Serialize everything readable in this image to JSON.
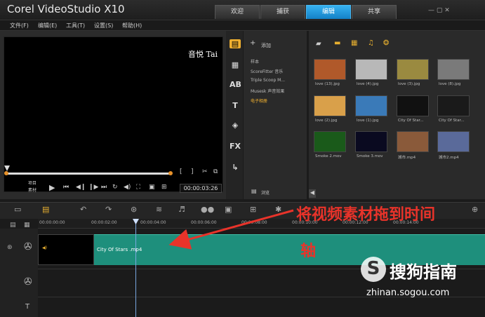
{
  "app": {
    "title": "Corel VideoStudio X10"
  },
  "workspace_tabs": [
    {
      "label": "欢迎"
    },
    {
      "label": "捕获"
    },
    {
      "label": "编辑"
    },
    {
      "label": "共享"
    }
  ],
  "menu": [
    {
      "label": "文件(F)"
    },
    {
      "label": "编辑(E)"
    },
    {
      "label": "工具(T)"
    },
    {
      "label": "设置(S)"
    },
    {
      "label": "帮助(H)"
    }
  ],
  "player": {
    "watermark": "音悦 Tai",
    "mode_project": "项目",
    "mode_clip": "素材",
    "timecode": "00:00:03:26"
  },
  "library": {
    "add_label": "添加",
    "browse_label": "浏览",
    "tree": [
      {
        "label": "样本"
      },
      {
        "label": "ScoreFitter 音乐"
      },
      {
        "label": "Triple Scoop M..."
      },
      {
        "label": "Musesk 声音效果"
      },
      {
        "label": "电子相册"
      }
    ],
    "media": [
      {
        "name": "love (13).jpg",
        "color": "#b0592a"
      },
      {
        "name": "love (4).jpg",
        "color": "#b8b8b8"
      },
      {
        "name": "love (3).jpg",
        "color": "#9a8a40"
      },
      {
        "name": "love (8).jpg",
        "color": "#7a7a7a"
      },
      {
        "name": "love (2).jpg",
        "color": "#d9a04a"
      },
      {
        "name": "love (1).jpg",
        "color": "#3a7ab8"
      },
      {
        "name": "City Of Star...",
        "color": "#111111"
      },
      {
        "name": "City Of Star...",
        "color": "#1a1a1a"
      },
      {
        "name": "Smoke 2.mov",
        "color": "#1a5a1a"
      },
      {
        "name": "Smoke 3.mov",
        "color": "#0a0a20"
      },
      {
        "name": "城市.mp4",
        "color": "#8a5a3a"
      },
      {
        "name": "城市2.mp4",
        "color": "#5a6a9a"
      }
    ]
  },
  "timeline": {
    "ruler": [
      "00:00:00:00",
      "00:00:02:00",
      "00:00:04:00",
      "00:00:06:00",
      "00:00:08:00",
      "00:00:10:00",
      "00:00:12:00",
      "00:00:14:00"
    ],
    "clip_name": "City Of Stars .mp4"
  },
  "annotation": {
    "line1": "将视频素材拖到时间",
    "line2": "轴",
    "color": "#e8332a"
  },
  "sogou": {
    "logo": "S",
    "name": "搜狗指南",
    "url": "zhinan.sogou.com"
  }
}
